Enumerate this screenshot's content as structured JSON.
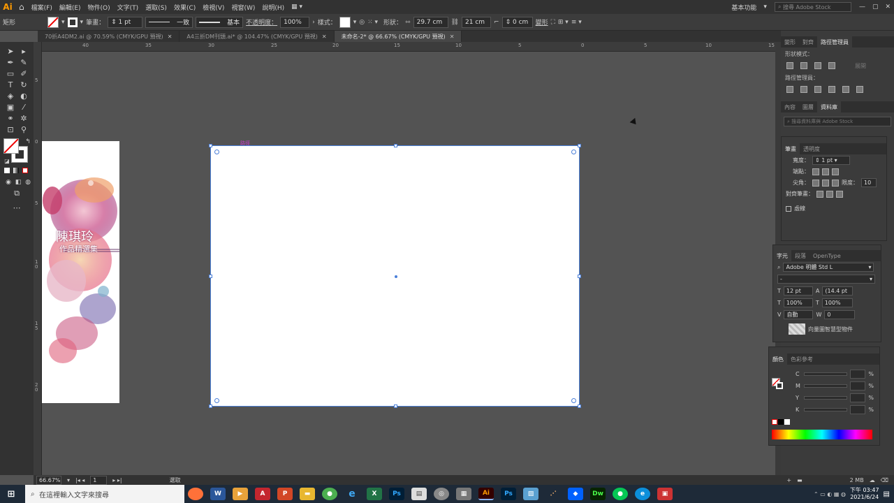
{
  "app": {
    "logo": "Ai"
  },
  "menu": {
    "items": [
      "檔案(F)",
      "編輯(E)",
      "物件(O)",
      "文字(T)",
      "選取(S)",
      "效果(C)",
      "檢視(V)",
      "視窗(W)",
      "說明(H)"
    ],
    "workspace": "基本功能",
    "search_placeholder": "搜尋 Adobe Stock"
  },
  "control": {
    "object_type": "矩形",
    "stroke_label": "筆畫：",
    "stroke_value": "1 pt",
    "uniform": "一致",
    "basic": "基本",
    "opacity_label": "不透明度：",
    "opacity_value": "100%",
    "style_label": "樣式：",
    "shape_label": "形狀：",
    "width": "29.7 cm",
    "height": "21 cm",
    "corner": "0 cm",
    "transform_label": "變形"
  },
  "tabs": [
    {
      "label": "70折A4DM2.ai @ 70.59% (CMYK/GPU 預視)",
      "active": false
    },
    {
      "label": "A4三折DM刊頭.ai* @ 104.47% (CMYK/GPU 預視)",
      "active": false
    },
    {
      "label": "未命名-2* @ 66.67% (CMYK/GPU 預視)",
      "active": true
    }
  ],
  "ruler": {
    "h_ticks": [
      "40",
      "35",
      "30",
      "25",
      "20",
      "15",
      "10",
      "5",
      "0",
      "5",
      "10",
      "15"
    ],
    "v_ticks": [
      "5",
      "0",
      "5",
      "1 0",
      "1 5",
      "2 0"
    ]
  },
  "artwork": {
    "name_line1": "陳琪玲",
    "name_line2": "作品精選集",
    "path_label": "路徑"
  },
  "right_panel": {
    "top_tabs": [
      "變形",
      "對齊",
      "路徑管理員"
    ],
    "shape_modes": "形狀模式：",
    "expand_btn": "展開",
    "pathfinders": "路徑管理員：",
    "lib_tabs": [
      "內容",
      "圖層",
      "資料庫"
    ],
    "lib_search": "搜尋資料庫與 Adobe Stock",
    "stroke_tabs": [
      "筆畫",
      "透明度"
    ],
    "weight_label": "寬度：",
    "weight_value": "1 pt",
    "cap_label": "端點：",
    "corner_label": "尖角：",
    "limit_label": "限度：",
    "limit_value": "10",
    "align_label": "對齊筆畫：",
    "dashed_label": "虛線"
  },
  "char_panel": {
    "tabs": [
      "字元",
      "段落",
      "OpenType"
    ],
    "font": "Adobe 明體 Std L",
    "style": "-",
    "size": "12 pt",
    "leading": "(14.4 pt",
    "vscale": "100%",
    "hscale": "100%",
    "kerning": "自動",
    "tracking": "0",
    "smart_object": "向量圖智慧型物件"
  },
  "color_panel": {
    "tabs": [
      "顏色",
      "色彩參考"
    ],
    "channels": [
      "C",
      "M",
      "Y",
      "K"
    ],
    "pct": "%"
  },
  "status": {
    "zoom": "66.67%",
    "artboard": "1",
    "mode": "選取",
    "memory": "2 MB"
  },
  "taskbar": {
    "search": "在這裡輸入文字來搜尋",
    "time": "下午 03:47",
    "date": "2021/6/24"
  }
}
